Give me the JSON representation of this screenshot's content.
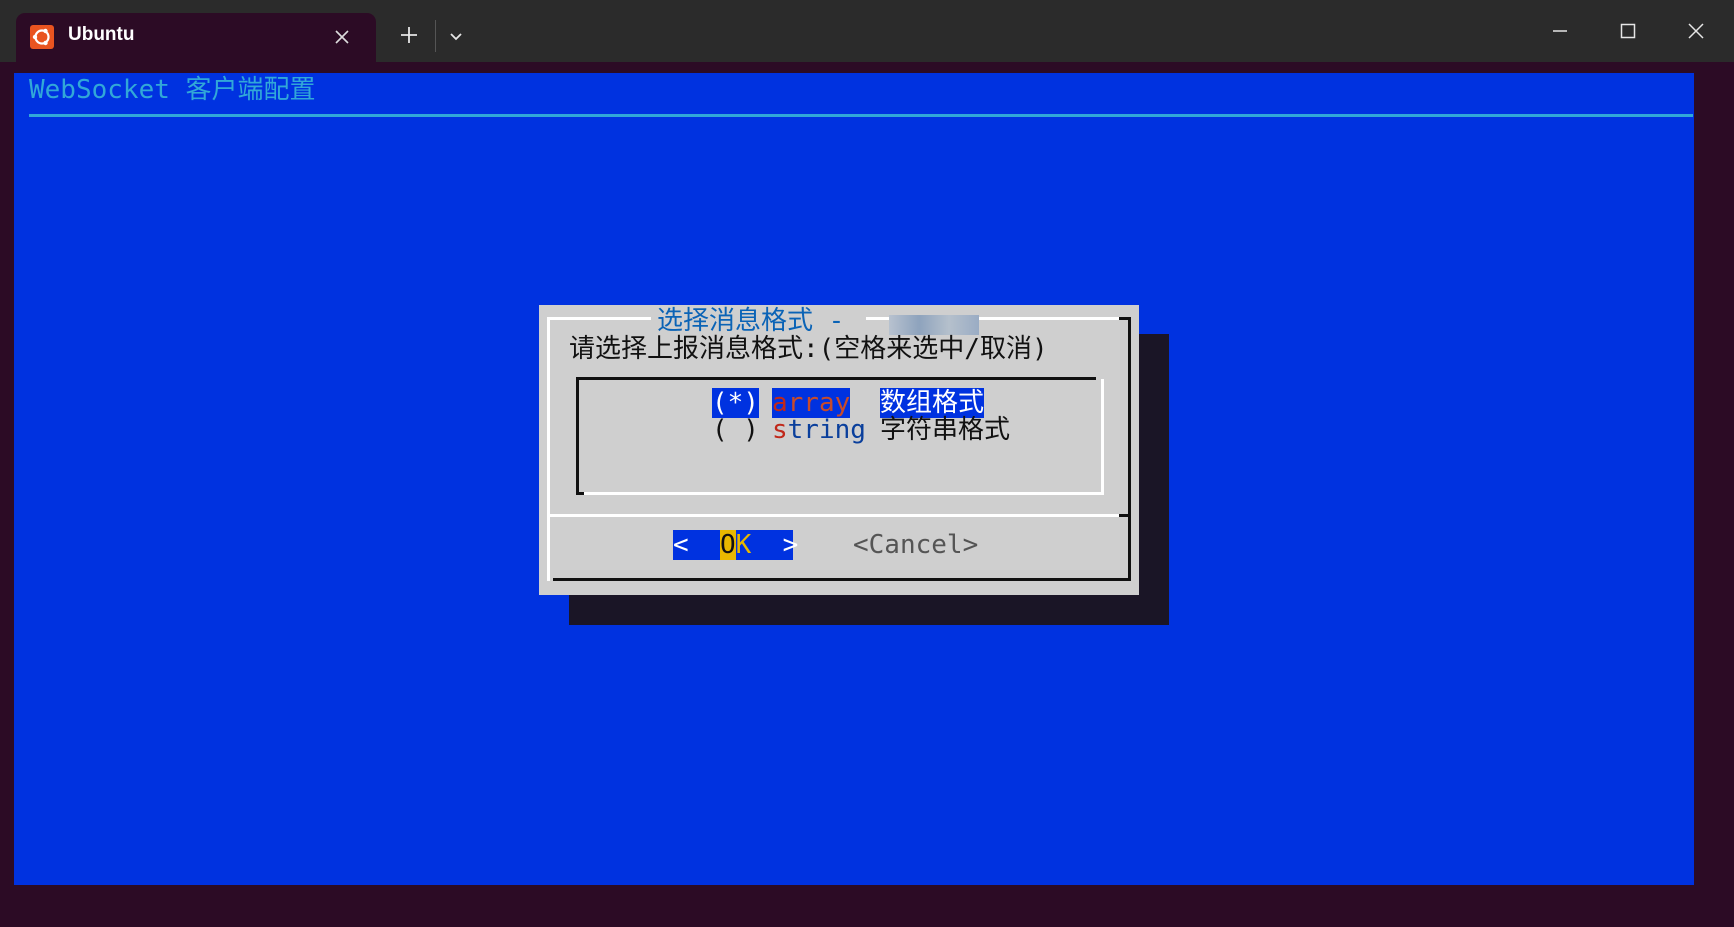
{
  "window": {
    "tab_title": "Ubuntu",
    "colors": {
      "titlebar": "#2b2b2b",
      "tab": "#2c0b25",
      "terminal_bg": "#0032e0"
    }
  },
  "terminal": {
    "backtitle": "WebSocket 客户端配置",
    "dialog": {
      "title": "选择消息格式 - ",
      "prompt": "请选择上报消息格式:(空格来选中/取消)",
      "options": [
        {
          "mark": "(*)",
          "tag_first": "a",
          "tag_rest": "rray",
          "item": "数组格式",
          "selected": true
        },
        {
          "mark": "( )",
          "tag_first": "s",
          "tag_rest": "tring",
          "item": "字符串格式",
          "selected": false
        }
      ],
      "ok": {
        "left": "<  ",
        "hot": "O",
        "rest": "K",
        "right": "  >"
      },
      "cancel": "<Cancel>"
    }
  }
}
